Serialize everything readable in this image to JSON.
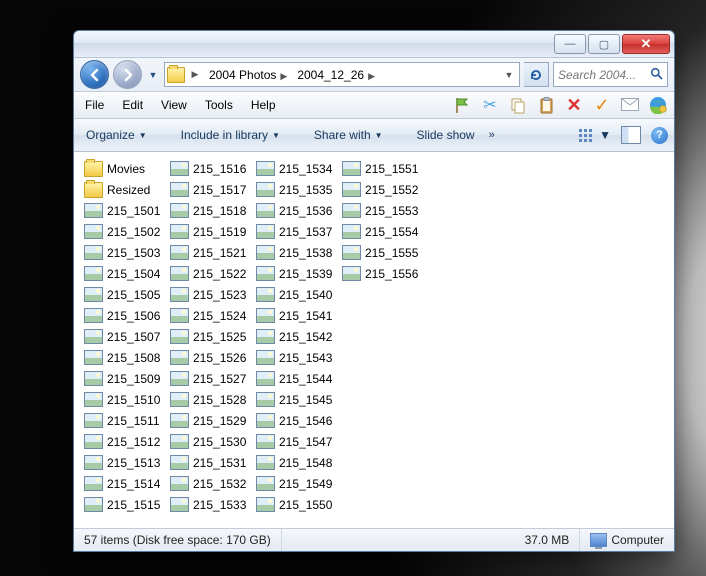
{
  "window_controls": {
    "minimize": "—",
    "maximize": "▢",
    "close": "✕"
  },
  "breadcrumb": [
    {
      "label": "2004 Photos"
    },
    {
      "label": "2004_12_26"
    }
  ],
  "search": {
    "placeholder": "Search 2004..."
  },
  "menu": {
    "file": "File",
    "edit": "Edit",
    "view": "View",
    "tools": "Tools",
    "help": "Help"
  },
  "cmd": {
    "organize": "Organize",
    "include": "Include in library",
    "share": "Share with",
    "slideshow": "Slide show"
  },
  "folders": [
    {
      "name": "Movies"
    },
    {
      "name": "Resized"
    }
  ],
  "files": [
    "215_1501",
    "215_1502",
    "215_1503",
    "215_1504",
    "215_1505",
    "215_1506",
    "215_1507",
    "215_1508",
    "215_1509",
    "215_1510",
    "215_1511",
    "215_1512",
    "215_1513",
    "215_1514",
    "215_1515",
    "215_1516",
    "215_1517",
    "215_1518",
    "215_1519",
    "215_1521",
    "215_1522",
    "215_1523",
    "215_1524",
    "215_1525",
    "215_1526",
    "215_1527",
    "215_1528",
    "215_1529",
    "215_1530",
    "215_1531",
    "215_1532",
    "215_1533",
    "215_1534",
    "215_1535",
    "215_1536",
    "215_1537",
    "215_1538",
    "215_1539",
    "215_1540",
    "215_1541",
    "215_1542",
    "215_1543",
    "215_1544",
    "215_1545",
    "215_1546",
    "215_1547",
    "215_1548",
    "215_1549",
    "215_1550",
    "215_1551",
    "215_1552",
    "215_1553",
    "215_1554",
    "215_1555",
    "215_1556"
  ],
  "status": {
    "items_count": "57 items",
    "disk_free": "(Disk free space: 170 GB)",
    "selection_size": "37.0 MB",
    "location": "Computer"
  }
}
